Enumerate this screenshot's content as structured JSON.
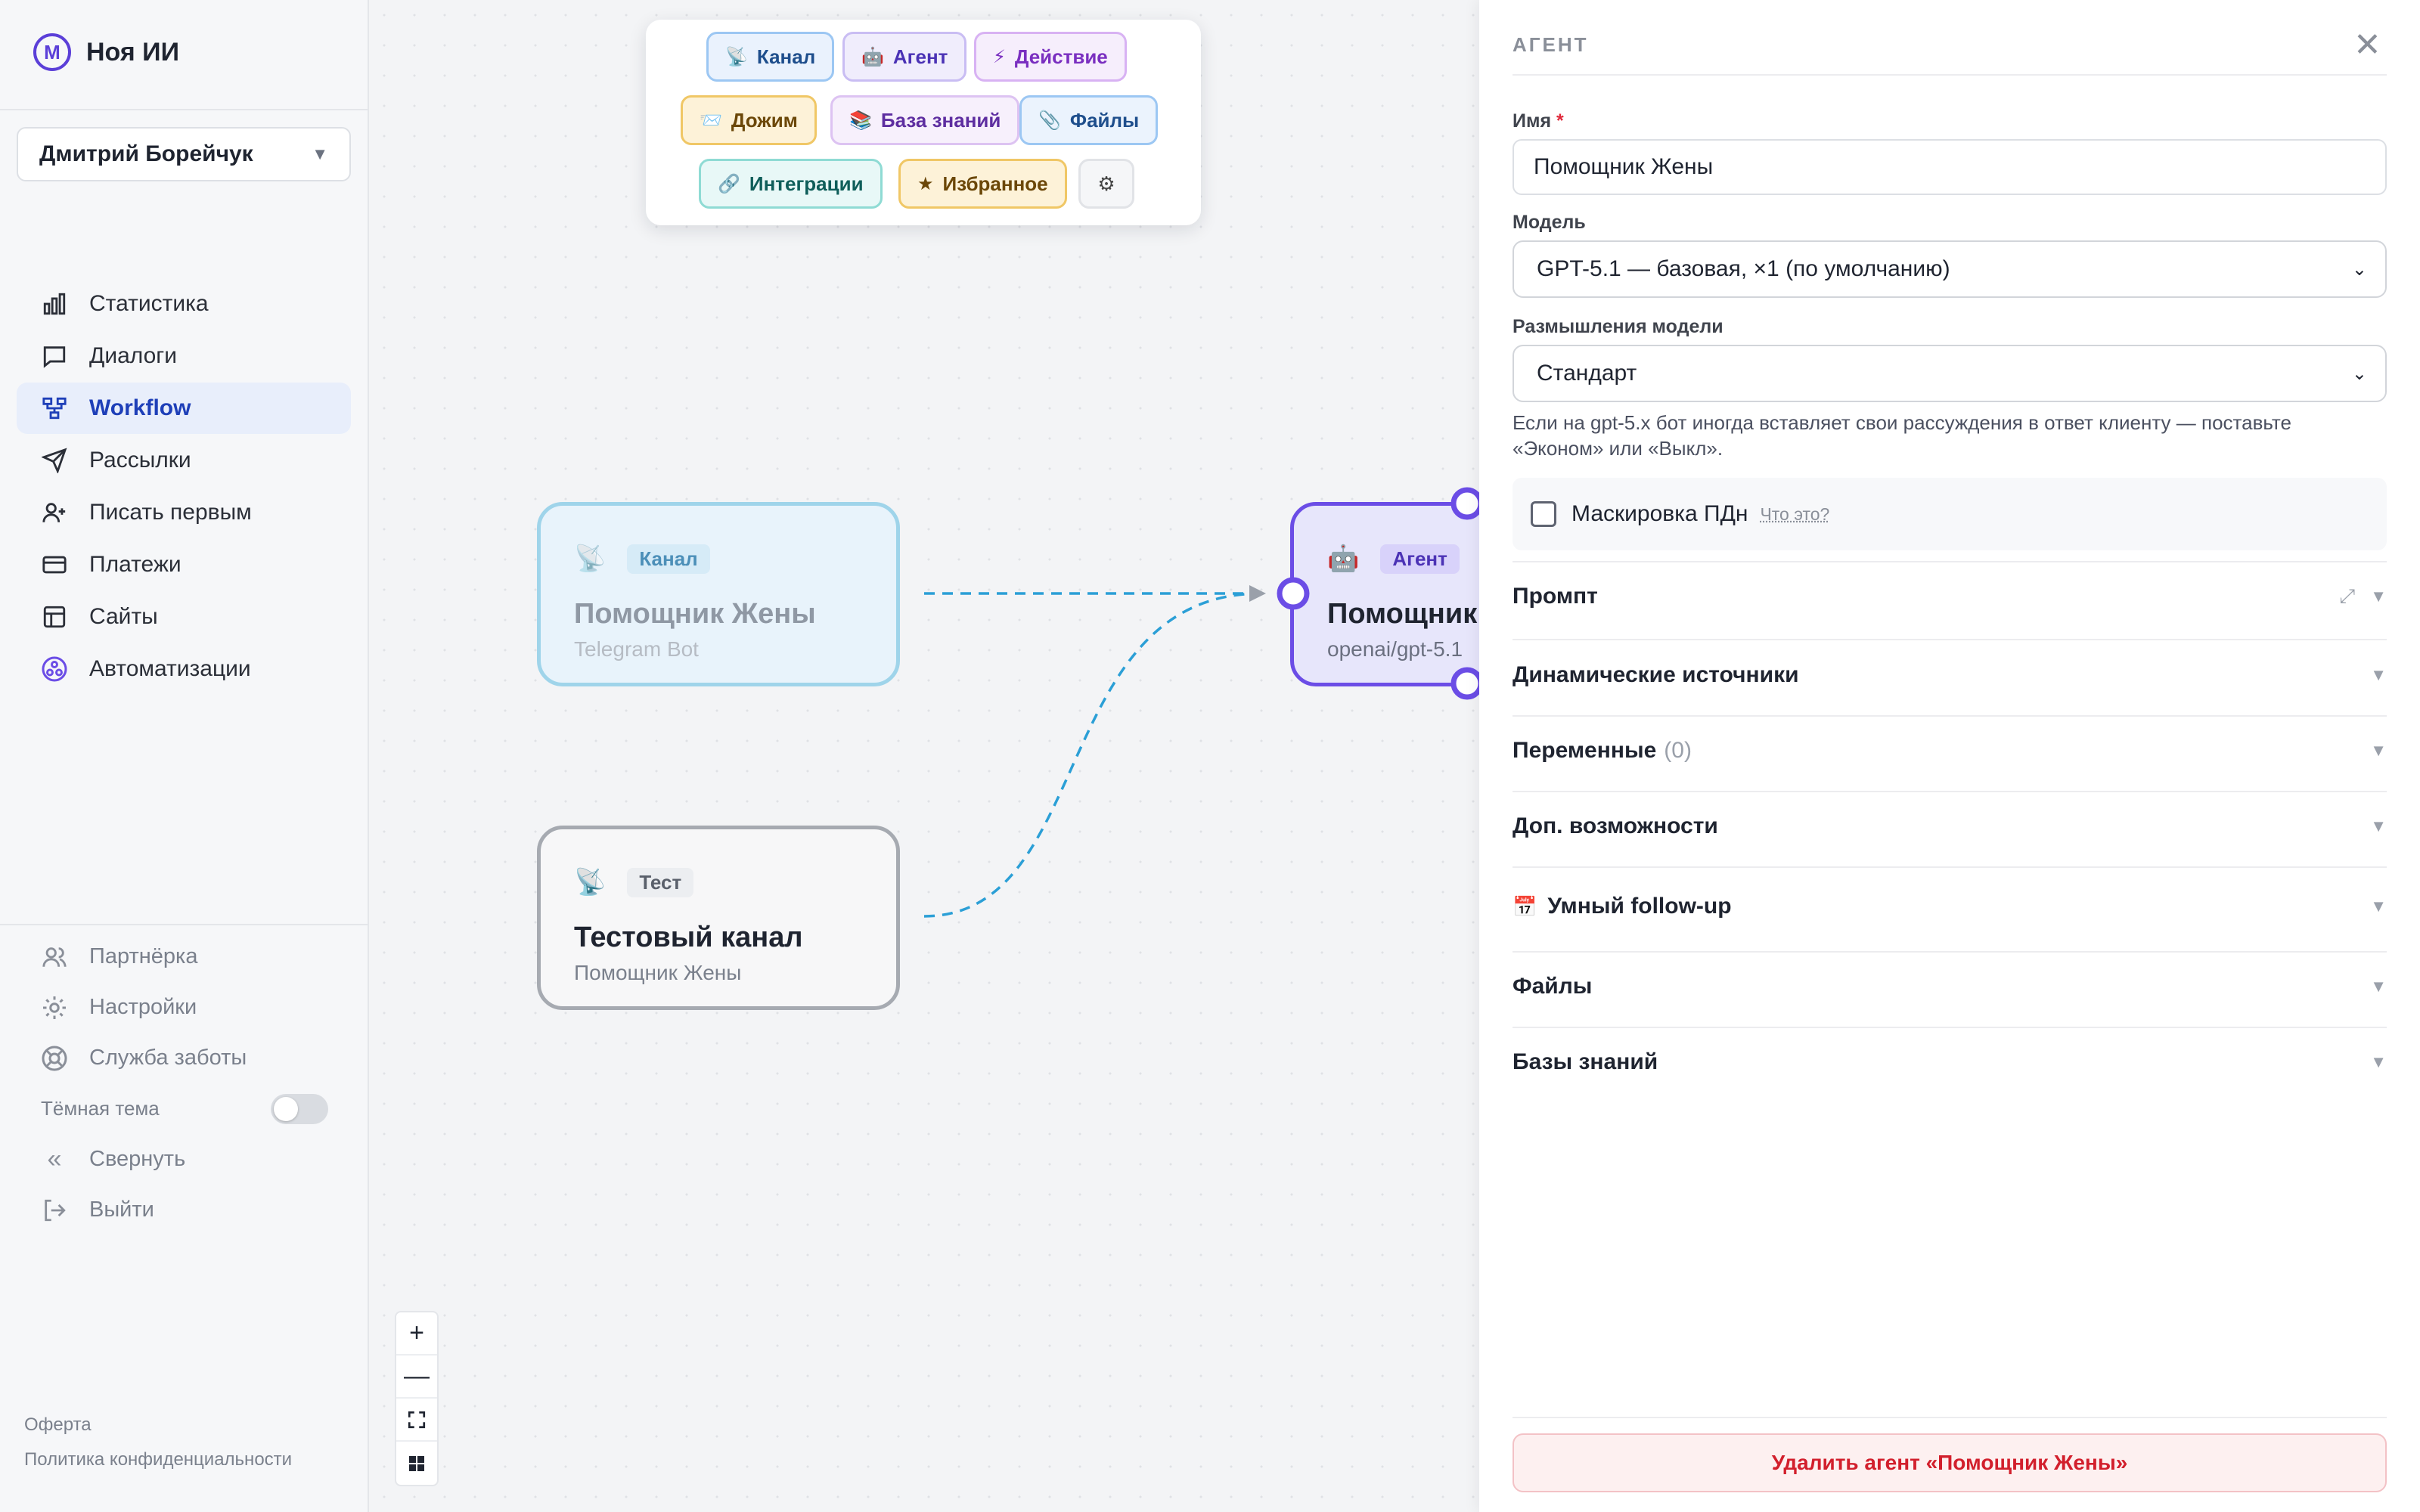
{
  "brand": {
    "logo_letter": "М",
    "name": "Ноя ИИ"
  },
  "user": {
    "name": "Дмитрий Борейчук"
  },
  "nav": [
    {
      "label": "Статистика",
      "icon": "bar-chart-icon"
    },
    {
      "label": "Диалоги",
      "icon": "chat-bubble-icon"
    },
    {
      "label": "Workflow",
      "icon": "workflow-icon",
      "active": true
    },
    {
      "label": "Рассылки",
      "icon": "send-icon"
    },
    {
      "label": "Писать первым",
      "icon": "user-plus-icon"
    },
    {
      "label": "Платежи",
      "icon": "credit-card-icon"
    },
    {
      "label": "Сайты",
      "icon": "layout-icon"
    },
    {
      "label": "Автоматизации",
      "icon": "automation-icon"
    }
  ],
  "bottom_nav": {
    "partner": "Партнёрка",
    "settings": "Настройки",
    "support": "Служба заботы",
    "theme": "Тёмная тема",
    "collapse": "Свернуть",
    "logout": "Выйти"
  },
  "theme_toggle_on": false,
  "legal": {
    "offer": "Оферта",
    "privacy": "Политика конфиденциальности"
  },
  "palette": {
    "channel": "Канал",
    "agent": "Агент",
    "action": "Действие",
    "followup": "Дожим",
    "knowledge": "База знаний",
    "files": "Файлы",
    "integrations": "Интеграции",
    "favorites": "Избранное",
    "settings_icon": "gear-icon"
  },
  "nodes": {
    "channel": {
      "tag": "Канал",
      "title": "Помощник Жены",
      "subtitle": "Telegram Bot"
    },
    "test": {
      "tag": "Тест",
      "title": "Тестовый канал",
      "subtitle": "Помощник Жены"
    },
    "agent": {
      "tag": "Агент",
      "title": "Помощник",
      "subtitle": "openai/gpt-5.1"
    }
  },
  "zoom": {
    "in": "+",
    "out": "—"
  },
  "panel": {
    "header": "АГЕНТ",
    "name_label": "Имя",
    "name_value": "Помощник Жены",
    "model_label": "Модель",
    "model_value": "GPT-5.1 — базовая, ×1 (по умолчанию)",
    "thinking_label": "Размышления модели",
    "thinking_value": "Стандарт",
    "hint": "Если на gpt-5.x бот иногда вставляет свои рассуждения в ответ клиенту — поставьте «Эконом» или «Выкл».",
    "pdn_label": "Маскировка ПДн",
    "pdn_checked": false,
    "pdn_help": "Что это?",
    "sections": {
      "prompt": "Промпт",
      "dynamic": "Динамические источники",
      "variables": "Переменные",
      "variables_count": "(0)",
      "extra": "Доп. возможности",
      "followup": "Умный follow-up",
      "files": "Файлы",
      "kb": "Базы знаний"
    },
    "delete_button": "Удалить агент «Помощник Жены»"
  },
  "colors": {
    "accent": "#1e3fb8",
    "agent_purple": "#6b4de6",
    "edge": "#2b9fd6",
    "danger": "#d21f2c"
  }
}
